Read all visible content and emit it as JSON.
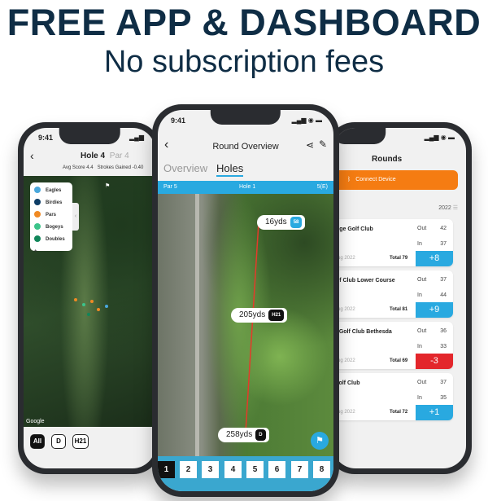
{
  "headline": "FREE APP & DASHBOARD",
  "subheadline": "No subscription fees",
  "colors": {
    "accent_blue": "#29a9e0",
    "orange": "#f57c12",
    "red": "#e3262b",
    "navy": "#0f2d45"
  },
  "left_phone": {
    "time": "9:41",
    "title": "Hole 4",
    "par": "Par 4",
    "avg_score": "Avg Score 4.4",
    "strokes_gained": "Strokes Gained -0.40",
    "legend": [
      {
        "label": "Eagles",
        "color": "#4aa8dc"
      },
      {
        "label": "Birdies",
        "color": "#0d3d66"
      },
      {
        "label": "Pars",
        "color": "#f08a24"
      },
      {
        "label": "Bogeys",
        "color": "#3cc48a"
      },
      {
        "label": "Doubles +",
        "color": "#11865a"
      }
    ],
    "map_credit": "Google",
    "filters": [
      "All",
      "D",
      "H21"
    ],
    "selected_filter": "All"
  },
  "center_phone": {
    "time": "9:41",
    "title": "Round Overview",
    "tabs": [
      "Overview",
      "Holes"
    ],
    "active_tab": "Holes",
    "par": "Par 5",
    "hole": "Hole 1",
    "score": "5(E)",
    "markers": [
      {
        "distance": "16yds",
        "club": "58"
      },
      {
        "distance": "205yds",
        "club": "H21"
      },
      {
        "distance": "258yds",
        "club": "D"
      }
    ],
    "holes": [
      "1",
      "2",
      "3",
      "4",
      "5",
      "6",
      "7",
      "8"
    ],
    "selected_hole": "1"
  },
  "right_phone": {
    "title": "Rounds",
    "connect_label": "Connect Device",
    "year": "2022",
    "rounds": [
      {
        "course": "idge Golf Club",
        "out": "42",
        "in": "37",
        "date": "Aug 2022",
        "total": "Total 79",
        "score": "+8",
        "color": "#29a9e0"
      },
      {
        "course": "olf Club Lower Course",
        "out": "37",
        "in": "44",
        "date": "Aug 2022",
        "total": "Total 81",
        "score": "+9",
        "color": "#29a9e0"
      },
      {
        "course": "s Golf Club Bethesda",
        "out": "36",
        "in": "33",
        "date": "Aug 2022",
        "total": "Total 69",
        "score": "-3",
        "color": "#e3262b"
      },
      {
        "course": "Golf Club",
        "out": "37",
        "in": "35",
        "date": "Aug 2022",
        "total": "Total 72",
        "score": "+1",
        "color": "#29a9e0"
      }
    ],
    "out_label": "Out",
    "in_label": "In"
  }
}
